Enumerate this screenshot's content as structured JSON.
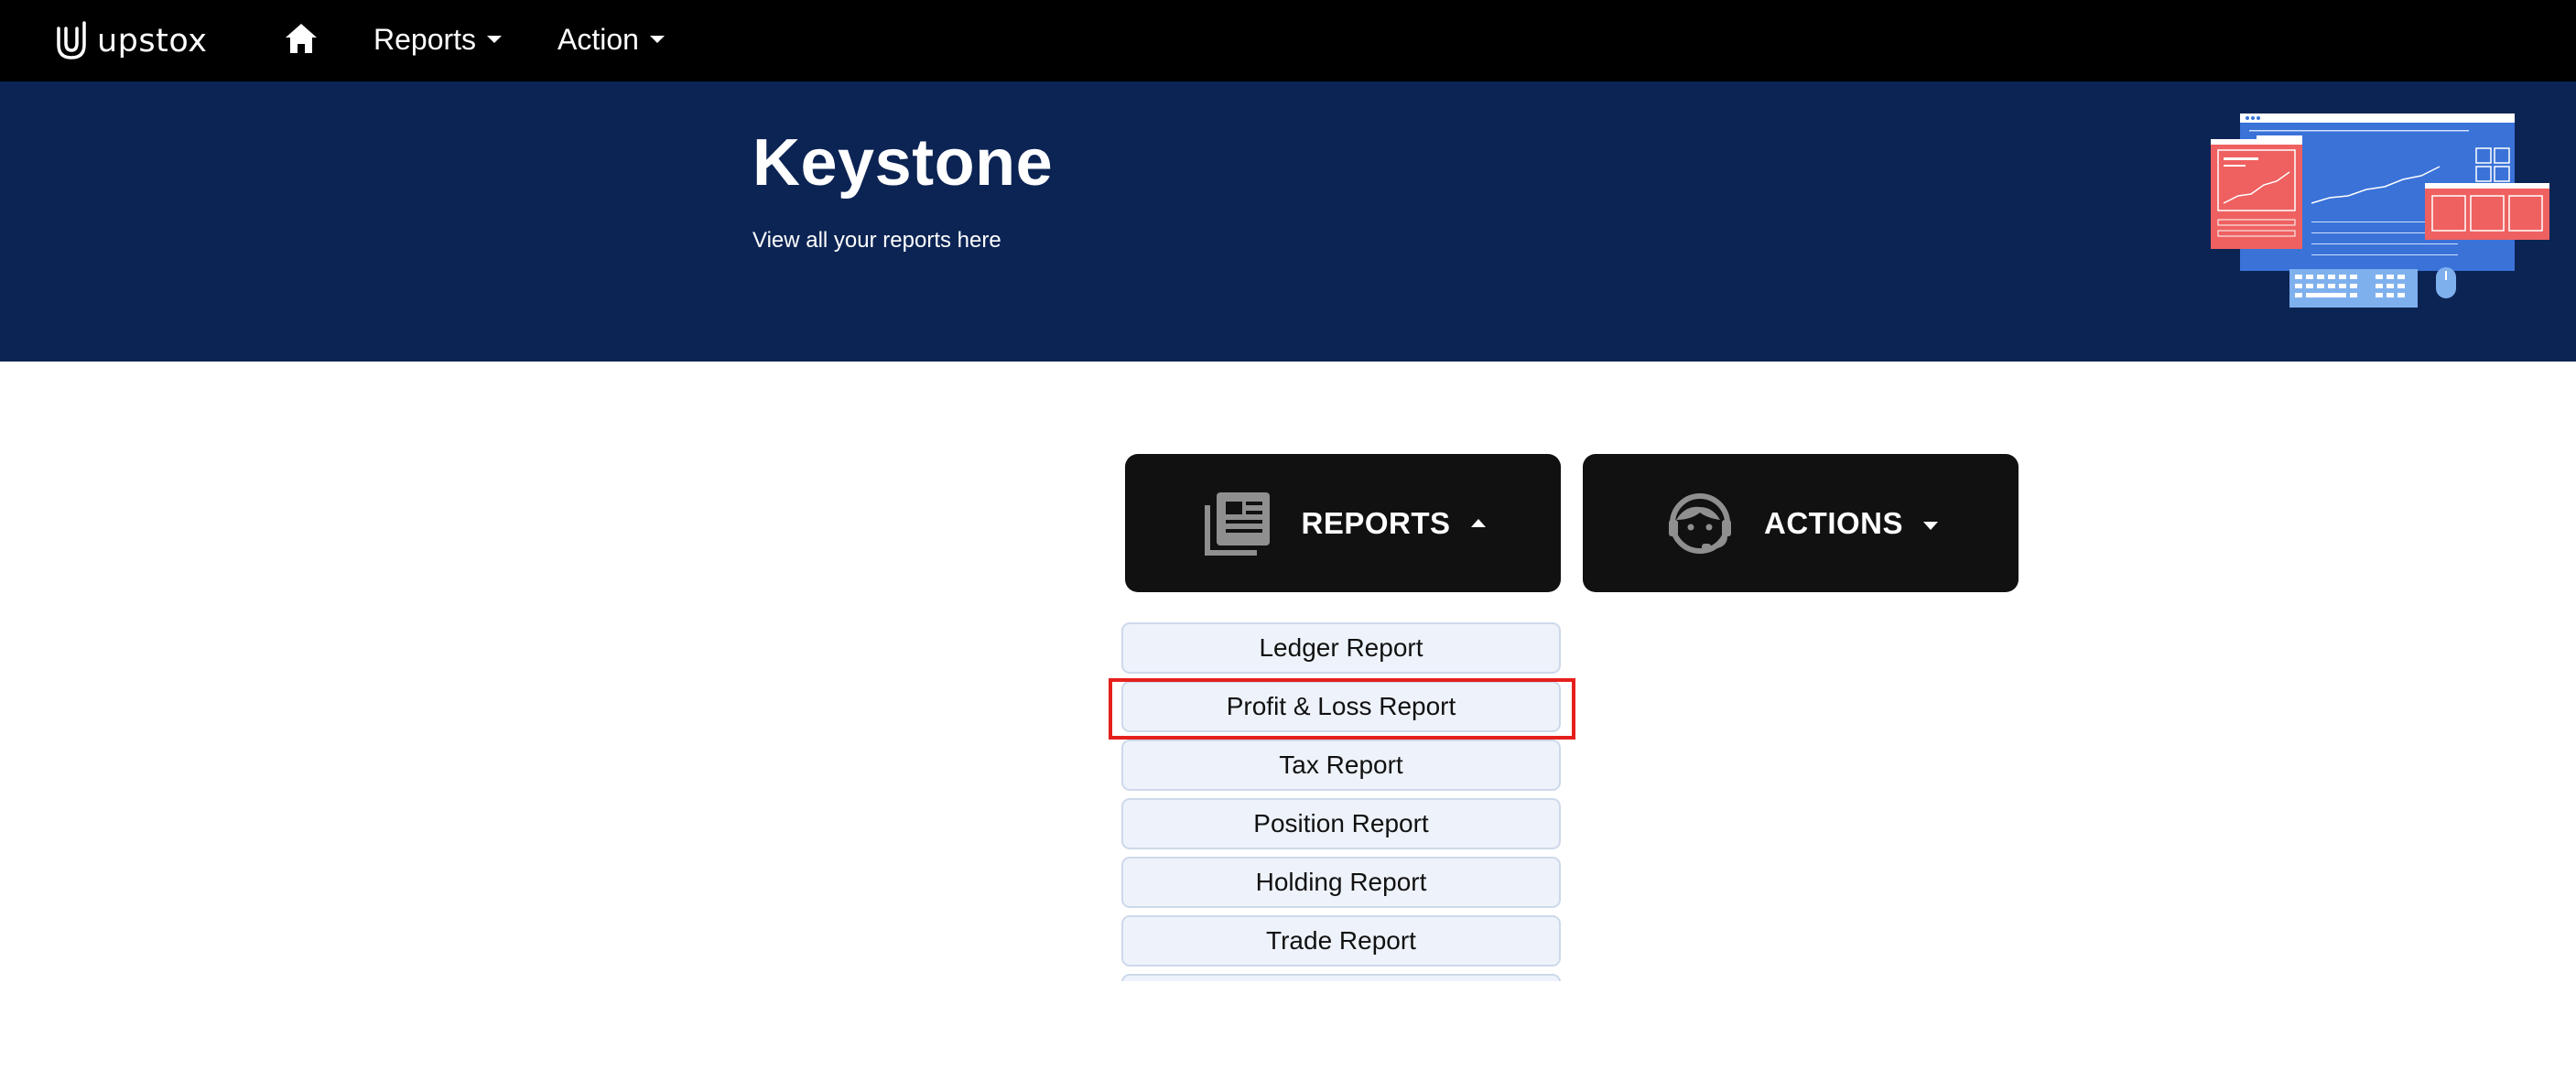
{
  "nav": {
    "brand": "upstox",
    "home_icon": "home-icon",
    "menus": [
      {
        "label": "Reports"
      },
      {
        "label": "Action"
      }
    ]
  },
  "hero": {
    "title": "Keystone",
    "subtitle": "View all your reports here"
  },
  "cards": {
    "reports": {
      "label": "REPORTS",
      "icon": "newspaper-icon",
      "expanded": true
    },
    "actions": {
      "label": "ACTIONS",
      "icon": "support-agent-icon",
      "expanded": false
    }
  },
  "reports_menu": {
    "items": [
      {
        "label": "Ledger Report"
      },
      {
        "label": "Profit & Loss Report",
        "highlighted": true
      },
      {
        "label": "Tax Report"
      },
      {
        "label": "Position Report"
      },
      {
        "label": "Holding Report"
      },
      {
        "label": "Trade Report"
      },
      {
        "label": ""
      }
    ]
  },
  "colors": {
    "nav_bg": "#000000",
    "hero_bg": "#0c2454",
    "card_bg": "#111111",
    "item_bg": "#eef3fb",
    "highlight": "#e5201c"
  }
}
